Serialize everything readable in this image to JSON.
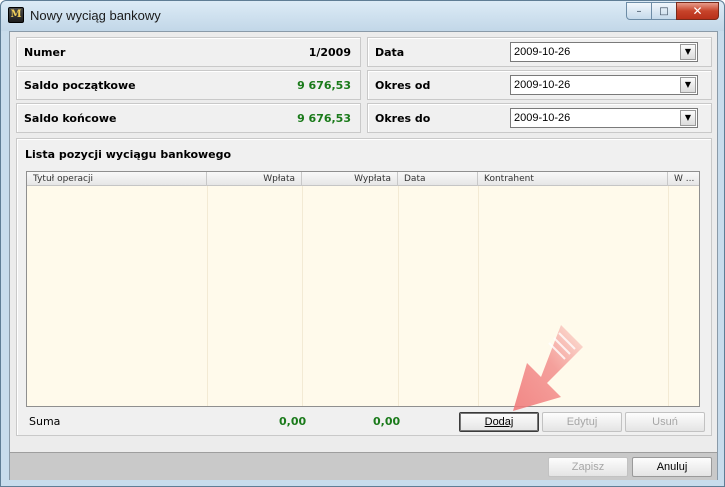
{
  "window": {
    "title": "Nowy wyciąg bankowy",
    "controls": {
      "minimize": "–",
      "maximize": "□",
      "close": "✕"
    }
  },
  "header": {
    "numer": {
      "label": "Numer",
      "value": "1/2009"
    },
    "saldo_poczatkowe": {
      "label": "Saldo początkowe",
      "value": "9 676,53"
    },
    "saldo_koncowe": {
      "label": "Saldo końcowe",
      "value": "9 676,53"
    },
    "data": {
      "label": "Data",
      "value": "2009-10-26"
    },
    "okres_od": {
      "label": "Okres od",
      "value": "2009-10-26"
    },
    "okres_do": {
      "label": "Okres do",
      "value": "2009-10-26"
    }
  },
  "list": {
    "title": "Lista pozycji wyciągu bankowego",
    "columns": [
      "Tytuł operacji",
      "Wpłata",
      "Wypłata",
      "Data",
      "Kontrahent",
      "W ..."
    ],
    "rows": []
  },
  "summary": {
    "label": "Suma",
    "wplata_total": "0,00",
    "wyplata_total": "0,00"
  },
  "list_buttons": {
    "add": "Dodaj",
    "edit": "Edytuj",
    "delete": "Usuń"
  },
  "footer_buttons": {
    "save": "Zapisz",
    "cancel": "Anuluj"
  },
  "icons": {
    "dropdown": "▼",
    "app": "M"
  },
  "colors": {
    "accent_green": "#1a7a1a",
    "grid_background": "#fffaeb",
    "hint_arrow": "#f07a7a"
  }
}
